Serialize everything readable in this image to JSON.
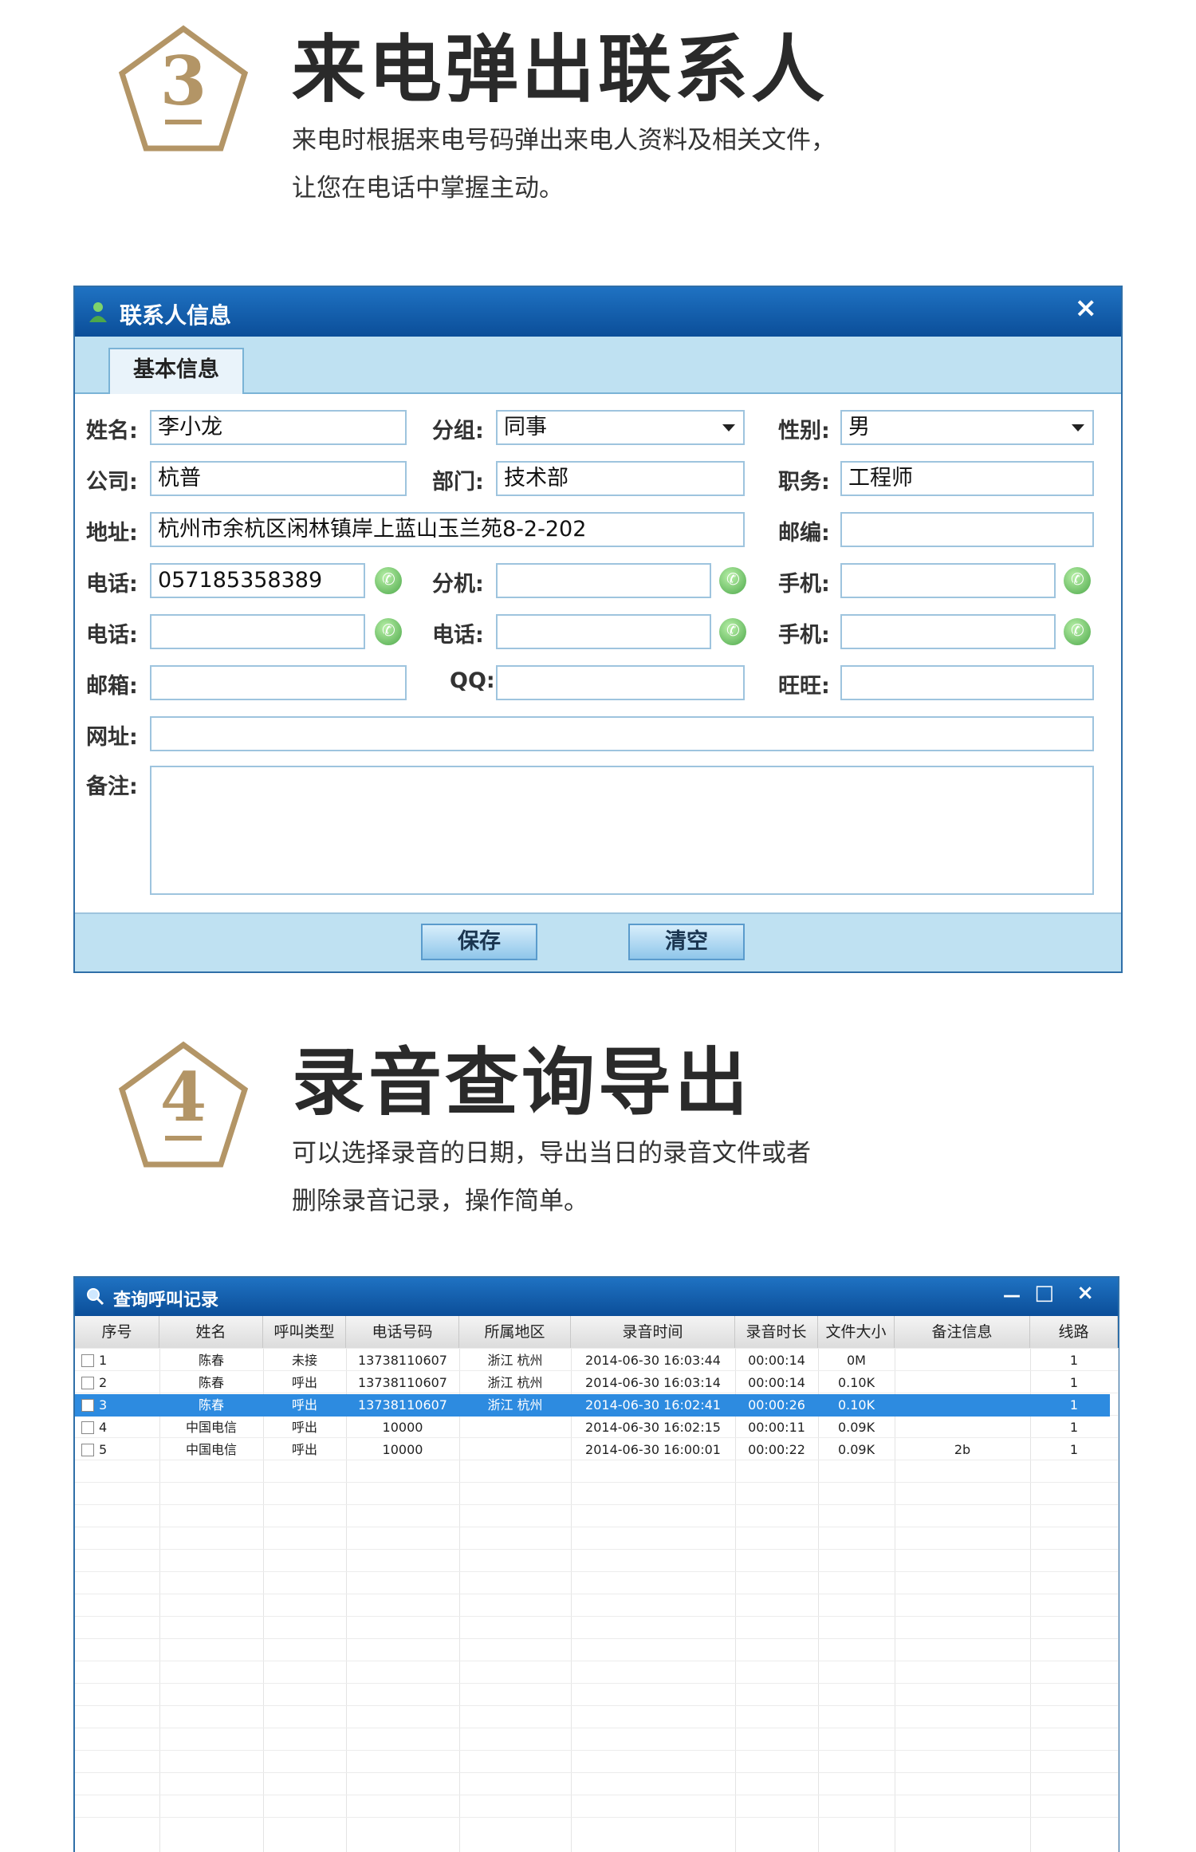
{
  "section3": {
    "number": "3",
    "title": "来电弹出联系人",
    "desc_line1": "来电时根据来电号码弹出来电人资料及相关文件，",
    "desc_line2": "让您在电话中掌握主动。"
  },
  "contact_window": {
    "title": "联系人信息",
    "close": "×",
    "tab": "基本信息",
    "labels": {
      "name": "姓名:",
      "group": "分组:",
      "gender": "性别:",
      "company": "公司:",
      "dept": "部门:",
      "position": "职务:",
      "address": "地址:",
      "zip": "邮编:",
      "phone1": "电话:",
      "ext": "分机:",
      "mobile1": "手机:",
      "phone2": "电话:",
      "phone3": "电话:",
      "mobile2": "手机:",
      "email": "邮箱:",
      "qq": "QQ:",
      "wangwang": "旺旺:",
      "website": "网址:",
      "note": "备注:"
    },
    "values": {
      "name": "李小龙",
      "group": "同事",
      "gender": "男",
      "company": "杭普",
      "dept": "技术部",
      "position": "工程师",
      "address": "杭州市余杭区闲林镇岸上蓝山玉兰苑8-2-202",
      "zip": "",
      "phone1": "057185358389",
      "ext": "",
      "mobile1": "",
      "phone2": "",
      "phone3": "",
      "mobile2": "",
      "email": "",
      "qq": "",
      "wangwang": "",
      "website": "",
      "note": ""
    },
    "save_button": "保存",
    "clear_button": "清空"
  },
  "section4": {
    "number": "4",
    "title": "录音查询导出",
    "desc_line1": "可以选择录音的日期，导出当日的录音文件或者",
    "desc_line2": "删除录音记录，操作简单。"
  },
  "records_window": {
    "title": "查询呼叫记录",
    "minimize": "－",
    "maximize": "□",
    "close": "×",
    "columns": [
      "序号",
      "姓名",
      "呼叫类型",
      "电话号码",
      "所属地区",
      "录音时间",
      "录音时长",
      "文件大小",
      "备注信息",
      "线路"
    ],
    "rows": [
      {
        "no": "1",
        "name": "陈春",
        "type": "未接",
        "phone": "13738110607",
        "region": "浙江 杭州",
        "time": "2014-06-30 16:03:44",
        "duration": "00:00:14",
        "size": "0M",
        "note": "",
        "line": "1"
      },
      {
        "no": "2",
        "name": "陈春",
        "type": "呼出",
        "phone": "13738110607",
        "region": "浙江 杭州",
        "time": "2014-06-30 16:03:14",
        "duration": "00:00:14",
        "size": "0.10K",
        "note": "",
        "line": "1"
      },
      {
        "no": "3",
        "name": "陈春",
        "type": "呼出",
        "phone": "13738110607",
        "region": "浙江 杭州",
        "time": "2014-06-30 16:02:41",
        "duration": "00:00:26",
        "size": "0.10K",
        "note": "",
        "line": "1"
      },
      {
        "no": "4",
        "name": "中国电信",
        "type": "呼出",
        "phone": "10000",
        "region": "",
        "time": "2014-06-30 16:02:15",
        "duration": "00:00:11",
        "size": "0.09K",
        "note": "",
        "line": "1"
      },
      {
        "no": "5",
        "name": "中国电信",
        "type": "呼出",
        "phone": "10000",
        "region": "",
        "time": "2014-06-30 16:00:01",
        "duration": "00:00:22",
        "size": "0.09K",
        "note": "2b",
        "line": "1"
      }
    ],
    "selected_row": 2
  },
  "colors": {
    "accent_gold": "#b39566",
    "title_blue": "#0b4e99",
    "selection_blue": "#2d8be0",
    "phone_green": "#4da84a"
  }
}
